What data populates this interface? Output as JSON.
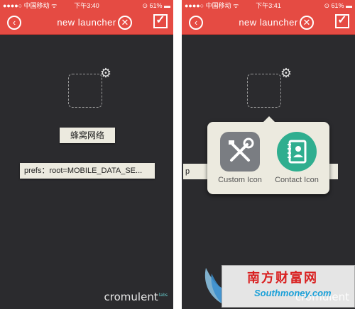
{
  "screens": [
    {
      "status": {
        "carrier": "●●●●○ 中国移动 ᯤ",
        "time": "下午3:40",
        "battery": "⊙ 61% ▬"
      },
      "nav": {
        "title": "new launcher"
      },
      "shortcut_name": "蜂窝网络",
      "prefs_value": "prefs：root=MOBILE_DATA_SE...",
      "logo": {
        "text": "cromulent",
        "sup": "labs"
      }
    },
    {
      "status": {
        "carrier": "●●●●○ 中国移动 ᯤ",
        "time": "下午3:41",
        "battery": "⊙ 61% ▬"
      },
      "nav": {
        "title": "new launcher"
      },
      "peek_text": "p",
      "popover": {
        "custom_label": "Custom Icon",
        "contact_label": "Contact Icon"
      },
      "logo": {
        "text": "cromulent"
      }
    }
  ],
  "watermark": {
    "chinese": "南方财富网",
    "url": "Southmoney.com"
  },
  "colors": {
    "accent": "#e54b43",
    "background": "#2b2b2e",
    "field": "#eceadf",
    "contact_icon": "#2fae8f",
    "tools_icon": "#7a7d82"
  },
  "icons": {
    "back": "back-arrow-icon",
    "close": "close-x-icon",
    "save": "checkmark-icon",
    "settings": "gear-icon",
    "custom": "wrench-screwdriver-icon",
    "contact": "contact-book-icon"
  }
}
